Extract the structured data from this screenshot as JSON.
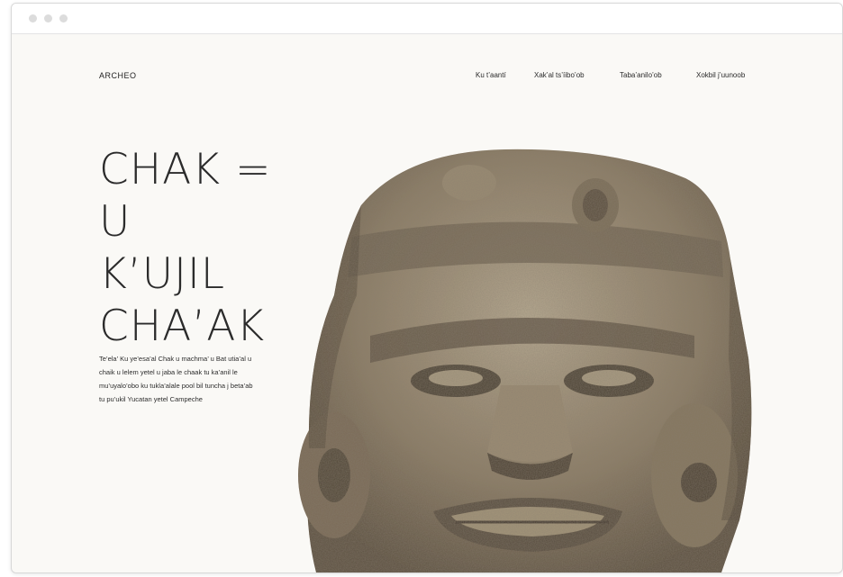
{
  "brand": "ARCHEO",
  "nav": [
    "Ku t’aantí",
    "Xak’al ts’íibo’ob",
    "Taba’anilo’ob",
    "Xokbil j’uunoob"
  ],
  "hero": {
    "title_lines": [
      "CHAK =",
      "U",
      "K’UJIL",
      "CHA’AK"
    ],
    "description": "Te’ela’ Ku ye’esa’al Chak u machma’ u Bat utia’al u chaik u lelem yetel u jaba le chaak tu ka’anil le mu’uyalo’obo ku tukla’alale pool bil tuncha j beta’ab tu pu’ukil Yucatan yetel Campeche"
  },
  "colors": {
    "page_background": "#faf9f6",
    "text": "#2b2b2b",
    "stone": "#8a7a63"
  }
}
